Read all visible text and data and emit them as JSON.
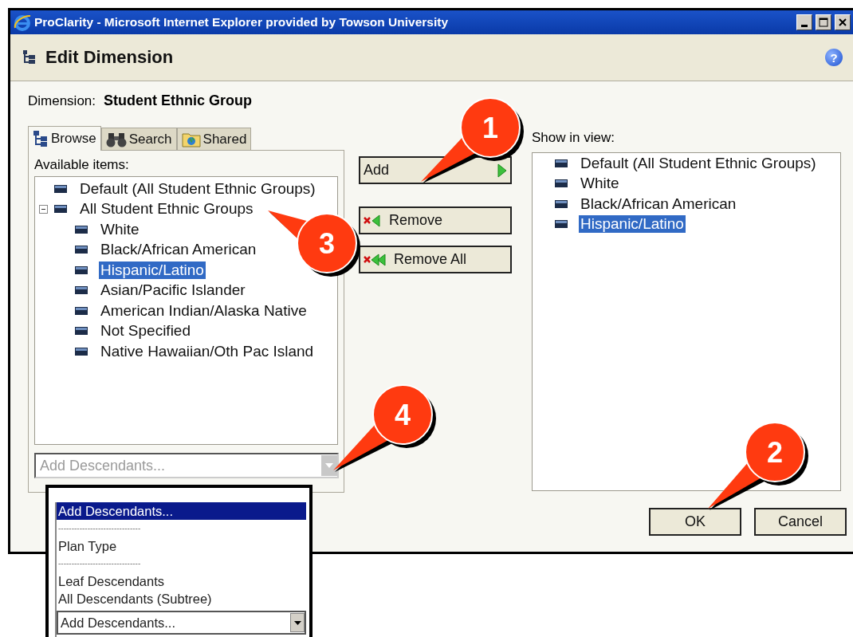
{
  "window": {
    "title": "ProClarity - Microsoft Internet Explorer provided by Towson University"
  },
  "header": {
    "title": "Edit Dimension",
    "help_button": "?"
  },
  "dimension": {
    "label": "Dimension:",
    "value": "Student Ethnic Group"
  },
  "tabs": [
    {
      "label": "Browse",
      "selected": true,
      "kind": "browse"
    },
    {
      "label": "Search",
      "selected": false,
      "kind": "search"
    },
    {
      "label": "Shared",
      "selected": false,
      "kind": "shared"
    }
  ],
  "available_label": "Available items:",
  "available_items": [
    {
      "label": "Default (All Student Ethnic Groups)",
      "selected": false
    },
    {
      "label": "All Student Ethnic Groups",
      "selected": false,
      "expanded": true,
      "children": [
        {
          "label": "White",
          "selected": false
        },
        {
          "label": "Black/African American",
          "selected": false
        },
        {
          "label": "Hispanic/Latino",
          "selected": true
        },
        {
          "label": "Asian/Pacific Islander",
          "selected": false
        },
        {
          "label": "American Indian/Alaska Native",
          "selected": false
        },
        {
          "label": "Not Specified",
          "selected": false
        },
        {
          "label": "Native Hawaiian/Oth Pac Island",
          "selected": false
        }
      ]
    }
  ],
  "descendants_select": {
    "value": "Add Descendants...",
    "disabled": true
  },
  "buttons": [
    {
      "label": "Add",
      "kind": "add"
    },
    {
      "label": "Remove",
      "kind": "remove"
    },
    {
      "label": "Remove All",
      "kind": "remove_all"
    }
  ],
  "show_label": "Show in view:",
  "show_items": [
    {
      "label": "Default (All Student Ethnic Groups)",
      "selected": false
    },
    {
      "label": "White",
      "selected": false
    },
    {
      "label": "Black/African American",
      "selected": false
    },
    {
      "label": "Hispanic/Latino",
      "selected": true
    }
  ],
  "footer_buttons": [
    "OK",
    "Cancel"
  ],
  "dropdown_popup": {
    "options": [
      {
        "label": "Add Descendants...",
        "kind": "option",
        "selected": true
      },
      {
        "label": "-------------------------------",
        "kind": "separator",
        "selected": false
      },
      {
        "label": "Plan Type",
        "kind": "option",
        "selected": false
      },
      {
        "label": "-------------------------------",
        "kind": "separator",
        "selected": false
      },
      {
        "label": "Leaf Descendants",
        "kind": "option",
        "selected": false
      },
      {
        "label": "All Descendants (Subtree)",
        "kind": "option",
        "selected": false
      }
    ],
    "combo_value": "Add Descendants..."
  },
  "callouts": [
    {
      "number": "1"
    },
    {
      "number": "3"
    },
    {
      "number": "4"
    },
    {
      "number": "2"
    }
  ]
}
